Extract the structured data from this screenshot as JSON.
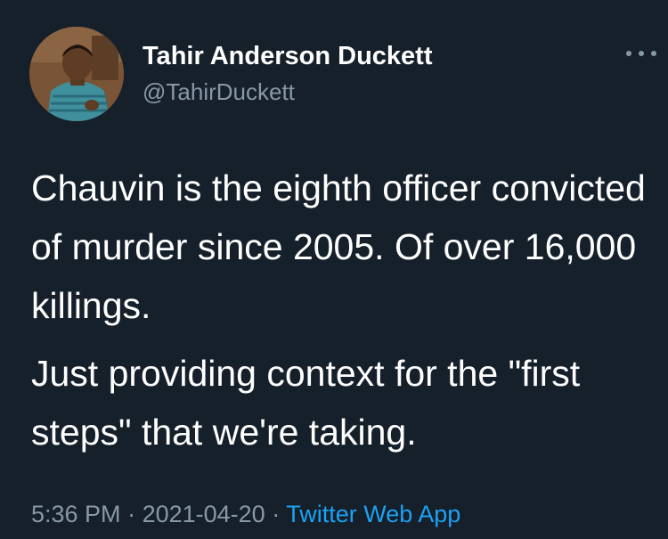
{
  "user": {
    "name": "Tahir Anderson Duckett",
    "handle": "@TahirDuckett",
    "avatar_icon": "child-portrait-avatar"
  },
  "tweet": {
    "paragraph1": "Chauvin is the eighth officer convicted of murder since 2005. Of over 16,000 killings.",
    "paragraph2": "Just providing context for the \"first steps\" that we're taking."
  },
  "meta": {
    "time": "5:36 PM",
    "separator1": " · ",
    "date": "2021-04-20",
    "separator2": " · ",
    "source": "Twitter Web App"
  },
  "colors": {
    "background": "#15202b",
    "text": "#ffffff",
    "secondary": "#8899a6",
    "link": "#1da1f2"
  },
  "more_icon": "more-horizontal-icon"
}
